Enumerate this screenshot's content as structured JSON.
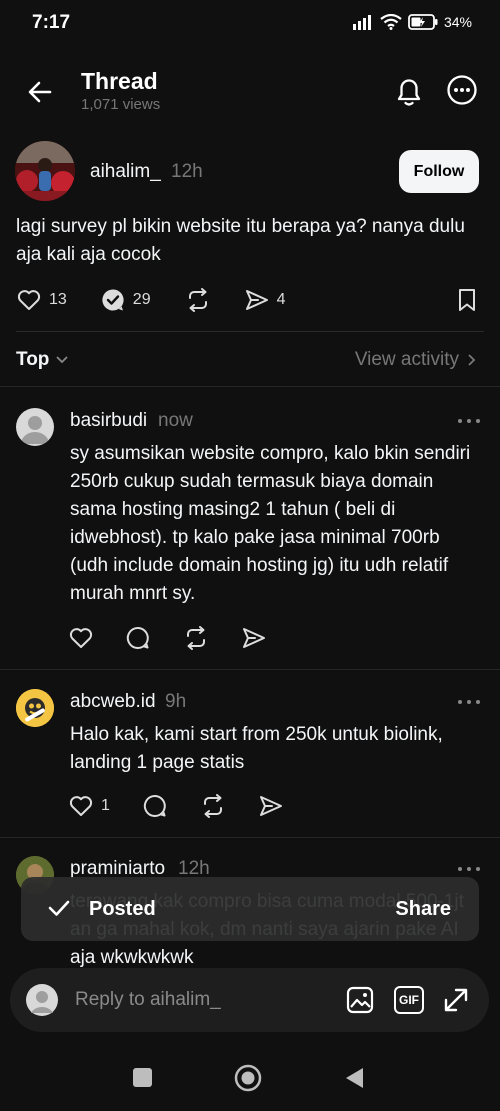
{
  "status": {
    "time": "7:17",
    "battery": "34%"
  },
  "header": {
    "title": "Thread",
    "views": "1,071 views"
  },
  "op": {
    "username": "aihalim_",
    "time": "12h",
    "follow_label": "Follow",
    "text": "lagi survey pl bikin website itu berapa ya? nanya dulu aja kali aja cocok",
    "likes": "13",
    "replies": "29",
    "shares": "4"
  },
  "sort": {
    "label": "Top",
    "view_activity": "View activity"
  },
  "replies": [
    {
      "username": "basirbudi",
      "time": "now",
      "text": "sy asumsikan website compro, kalo bkin sendiri 250rb cukup sudah termasuk biaya domain sama hosting masing2 1 tahun ( beli di idwebhost). tp kalo pake jasa minimal 700rb (udh include domain hosting jg) itu udh relatif murah mnrt sy.",
      "likes": ""
    },
    {
      "username": "abcweb.id",
      "time": "9h",
      "text": "Halo kak, kami start from 250k untuk biolink, landing 1 page statis",
      "likes": "1"
    },
    {
      "username": "praminiarto",
      "time": "12h",
      "text": "terawang kak compro bisa cuma modal 500-1jt an ga mahal kok, dm nanti saya ajarin pake AI aja wkwkwkwk"
    }
  ],
  "toast": {
    "label": "Posted",
    "action": "Share"
  },
  "composer": {
    "placeholder": "Reply to aihalim_",
    "gif_label": "GIF"
  },
  "colors": {
    "background": "#101010",
    "text": "#f3f5f7",
    "muted": "#777777",
    "button": "#f3f5f7"
  }
}
